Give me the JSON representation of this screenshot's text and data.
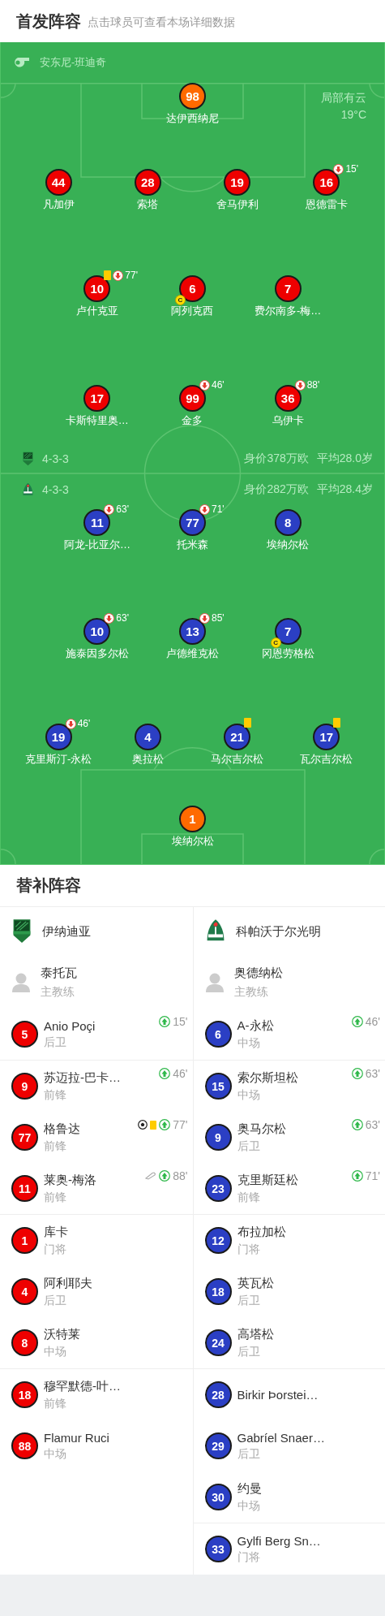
{
  "header": {
    "title": "首发阵容",
    "subtitle": "点击球员可查看本场详细数据"
  },
  "pitch": {
    "referee": "安东尼-班迪奇",
    "weather": "局部有云",
    "temperature": "19°C",
    "home": {
      "kind": "home",
      "formation": "4-3-3",
      "value": "身价378万欧",
      "age": "平均28.0岁",
      "lines": [
        [
          {
            "number": "98",
            "name": "达伊西纳尼",
            "kind": "goalkeeper",
            "yellow_card": false
          }
        ],
        [
          {
            "number": "44",
            "name": "凡加伊",
            "kind": "outfield",
            "yellow_card": false
          },
          {
            "number": "28",
            "name": "索塔",
            "kind": "outfield",
            "yellow_card": false
          },
          {
            "number": "19",
            "name": "舍马伊利",
            "kind": "outfield",
            "yellow_card": false
          },
          {
            "number": "16",
            "name": "恩德雷卡",
            "kind": "outfield",
            "yellow_card": false,
            "subbed_off": "15'"
          }
        ],
        [
          {
            "number": "10",
            "name": "卢什克亚",
            "kind": "outfield",
            "yellow_card": true,
            "subbed_off": "77'"
          },
          {
            "number": "6",
            "name": "阿列克西",
            "kind": "outfield",
            "yellow_card": false,
            "captain": "C"
          },
          {
            "number": "7",
            "name": "费尔南多-梅…",
            "kind": "outfield",
            "yellow_card": false
          }
        ],
        [
          {
            "number": "17",
            "name": "卡斯特里奥…",
            "kind": "outfield",
            "yellow_card": false
          },
          {
            "number": "99",
            "name": "金多",
            "kind": "outfield",
            "yellow_card": false,
            "subbed_off": "46'"
          },
          {
            "number": "36",
            "name": "乌伊卡",
            "kind": "outfield",
            "yellow_card": false,
            "subbed_off": "88'"
          }
        ]
      ]
    },
    "away": {
      "kind": "away",
      "formation": "4-3-3",
      "value": "身价282万欧",
      "age": "平均28.4岁",
      "lines": [
        [
          {
            "number": "11",
            "name": "阿龙-比亚尔…",
            "kind": "outfield",
            "yellow_card": false,
            "subbed_off": "63'"
          },
          {
            "number": "77",
            "name": "托米森",
            "kind": "outfield",
            "yellow_card": false,
            "subbed_off": "71'"
          },
          {
            "number": "8",
            "name": "埃纳尔松",
            "kind": "outfield",
            "yellow_card": false
          }
        ],
        [
          {
            "number": "10",
            "name": "施泰因多尔松",
            "kind": "outfield",
            "yellow_card": false,
            "subbed_off": "63'"
          },
          {
            "number": "13",
            "name": "卢德维克松",
            "kind": "outfield",
            "yellow_card": false,
            "subbed_off": "85'"
          },
          {
            "number": "7",
            "name": "冈恩劳格松",
            "kind": "outfield",
            "yellow_card": false,
            "captain": "C"
          }
        ],
        [
          {
            "number": "19",
            "name": "克里斯汀-永松",
            "kind": "outfield",
            "yellow_card": false,
            "subbed_off": "46'"
          },
          {
            "number": "4",
            "name": "奥拉松",
            "kind": "outfield",
            "yellow_card": false
          },
          {
            "number": "21",
            "name": "马尔吉尔松",
            "kind": "outfield",
            "yellow_card": true
          },
          {
            "number": "17",
            "name": "瓦尔吉尔松",
            "kind": "outfield",
            "yellow_card": true
          }
        ],
        [
          {
            "number": "1",
            "name": "埃纳尔松",
            "kind": "goalkeeper",
            "yellow_card": false
          }
        ]
      ]
    }
  },
  "substitutes": {
    "title": "替补阵容",
    "teams": [
      {
        "kind": "home",
        "name": "伊纳迪亚",
        "coach": {
          "name": "泰托瓦",
          "role": "主教练"
        },
        "groups": [
          [
            {
              "number": "5",
              "name": "Anio Poçi",
              "position": "后卫",
              "subbed_on": "15'"
            }
          ],
          [
            {
              "number": "9",
              "name": "苏迈拉-巴卡…",
              "position": "前锋",
              "subbed_on": "46'"
            },
            {
              "number": "77",
              "name": "格鲁达",
              "position": "前锋",
              "marks": [
                {
                  "kind": "goal"
                },
                {
                  "kind": "yellow_card"
                }
              ],
              "subbed_on": "77'"
            },
            {
              "number": "11",
              "name": "莱奥-梅洛",
              "position": "前锋",
              "marks": [
                {
                  "kind": "assist"
                }
              ],
              "subbed_on": "88'"
            }
          ],
          [
            {
              "number": "1",
              "name": "库卡",
              "position": "门将"
            },
            {
              "number": "4",
              "name": "阿利耶夫",
              "position": "后卫"
            },
            {
              "number": "8",
              "name": "沃特莱",
              "position": "中场"
            }
          ],
          [
            {
              "number": "18",
              "name": "穆罕默德-叶…",
              "position": "前锋"
            },
            {
              "number": "88",
              "name": "Flamur Ruci",
              "position": "中场"
            }
          ]
        ]
      },
      {
        "kind": "away",
        "name": "科帕沃于尔光明",
        "coach": {
          "name": "奥德纳松",
          "role": "主教练"
        },
        "groups": [
          [
            {
              "number": "6",
              "name": "A-永松",
              "position": "中场",
              "subbed_on": "46'"
            }
          ],
          [
            {
              "number": "15",
              "name": "索尔斯坦松",
              "position": "中场",
              "subbed_on": "63'"
            },
            {
              "number": "9",
              "name": "奥马尔松",
              "position": "后卫",
              "subbed_on": "63'"
            },
            {
              "number": "23",
              "name": "克里斯廷松",
              "position": "前锋",
              "subbed_on": "71'"
            }
          ],
          [
            {
              "number": "12",
              "name": "布拉加松",
              "position": "门将"
            },
            {
              "number": "18",
              "name": "英瓦松",
              "position": "后卫"
            },
            {
              "number": "24",
              "name": "高塔松",
              "position": "后卫"
            }
          ],
          [
            {
              "number": "28",
              "name": "Birkir Þorstei…"
            },
            {
              "number": "29",
              "name": "Gabríel Snaer…",
              "position": "后卫"
            },
            {
              "number": "30",
              "name": "约曼",
              "position": "中场"
            }
          ],
          [
            {
              "number": "33",
              "name": "Gylfi Berg Sn…",
              "position": "门将"
            }
          ]
        ]
      }
    ]
  }
}
